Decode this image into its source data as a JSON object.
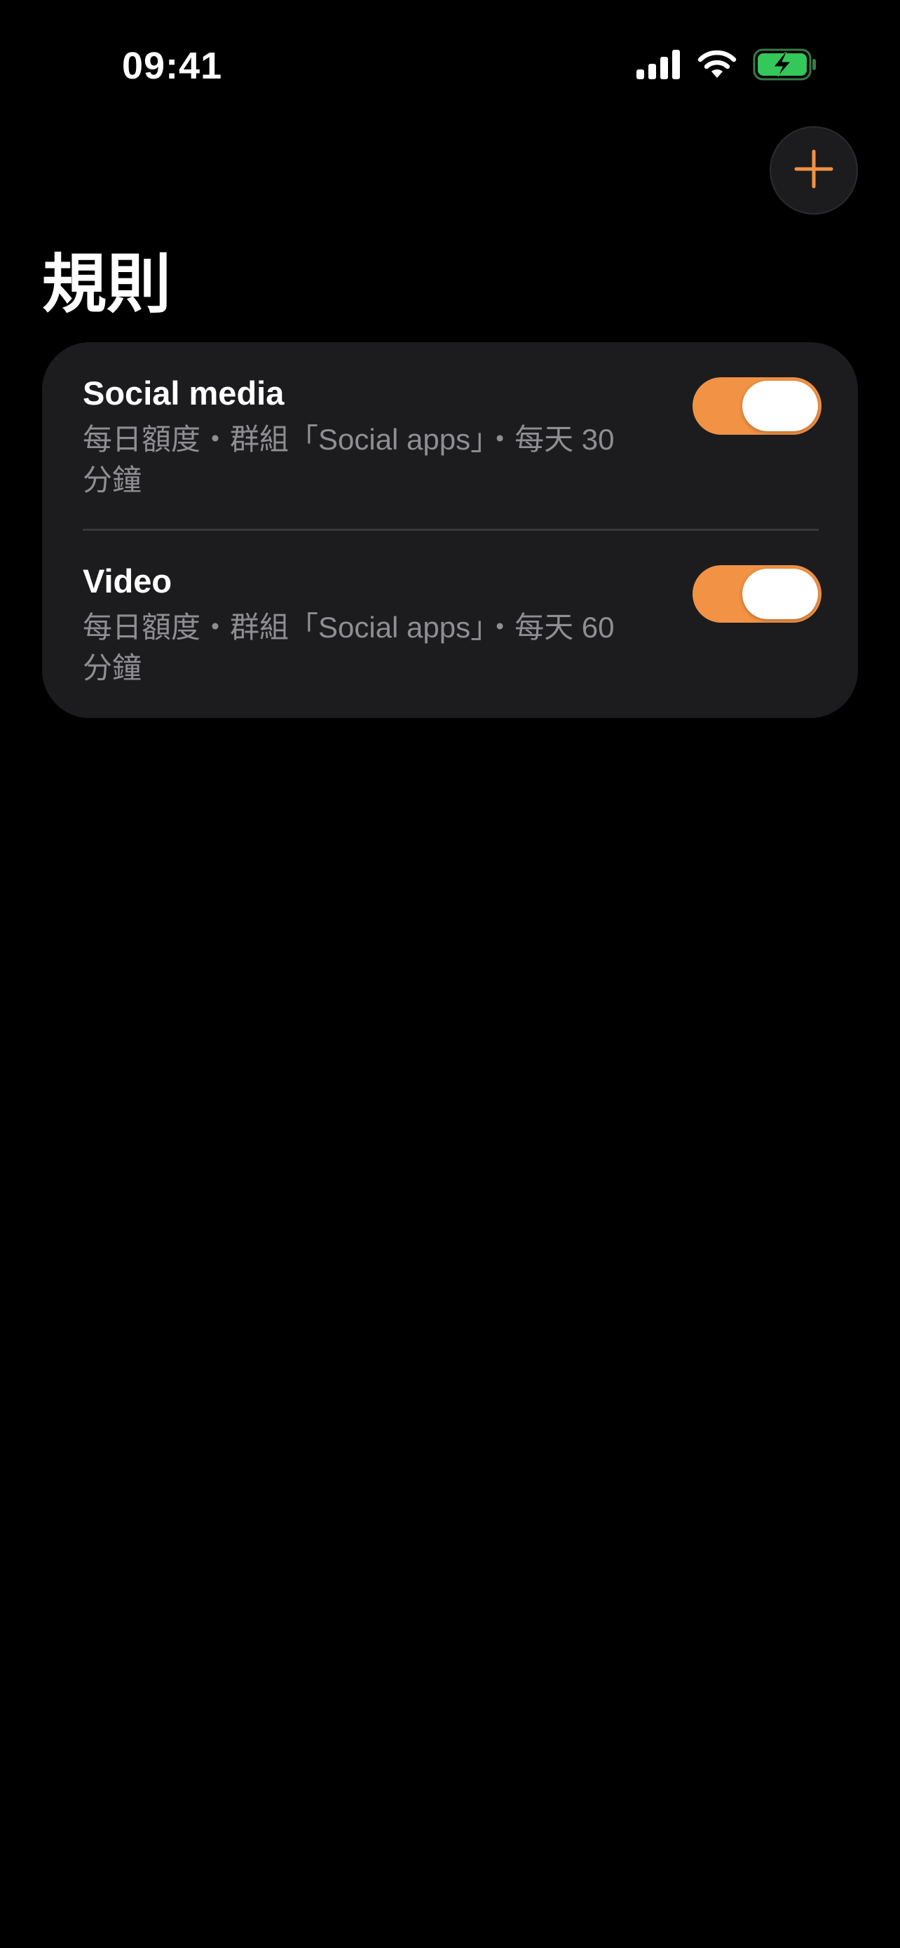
{
  "status_bar": {
    "time": "09:41",
    "battery_color": "#34c759"
  },
  "header": {
    "title": "規則",
    "add_button_icon": "plus-icon"
  },
  "rules": [
    {
      "name": "Social media",
      "description": "每日額度・群組「Social apps」・每天 30 分鐘",
      "enabled": true
    },
    {
      "name": "Video",
      "description": "每日額度・群組「Social apps」・每天 60 分鐘",
      "enabled": true
    }
  ],
  "theme": {
    "accent": "#f29244",
    "background": "#000000",
    "card": "#1c1c1e",
    "secondary_text": "#8e8e93"
  }
}
